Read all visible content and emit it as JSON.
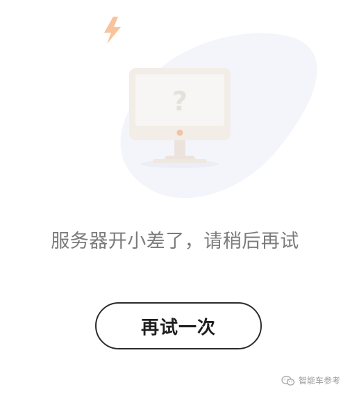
{
  "illustration": {
    "question_mark": "?",
    "icons": [
      "lightning-icon",
      "monitor-icon"
    ],
    "colors": {
      "lightning": "#f9c39c",
      "monitor_frame": "#f3ede7",
      "monitor_screen": "#f7f6f4",
      "monitor_dot": "#f2c3a4",
      "backdrop": "#f4f5fb"
    }
  },
  "message": {
    "error_text": "服务器开小差了，请稍后再试"
  },
  "actions": {
    "retry_label": "再试一次"
  },
  "watermark": {
    "icon": "wechat-icon",
    "account_name": "智能车参考"
  }
}
